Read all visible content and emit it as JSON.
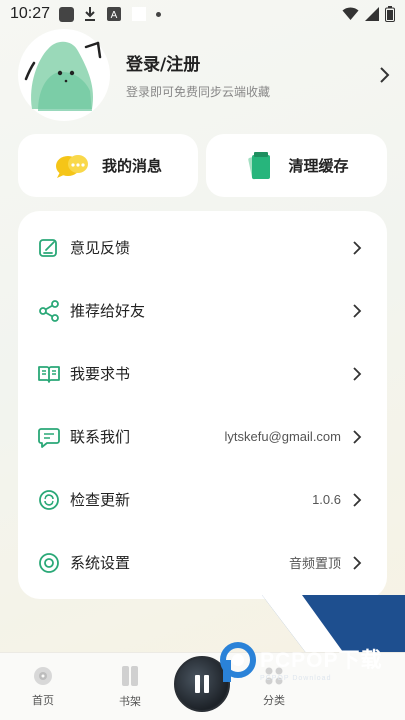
{
  "status_bar": {
    "time": "10:27"
  },
  "profile": {
    "title": "登录/注册",
    "subtitle": "登录即可免费同步云端收藏"
  },
  "quick_actions": [
    {
      "label": "我的消息",
      "icon": "chat-bubbles-icon"
    },
    {
      "label": "清理缓存",
      "icon": "broom-cards-icon"
    }
  ],
  "menu": [
    {
      "label": "意见反馈",
      "value": "",
      "icon": "feedback-edit-icon"
    },
    {
      "label": "推荐给好友",
      "value": "",
      "icon": "share-icon"
    },
    {
      "label": "我要求书",
      "value": "",
      "icon": "book-icon"
    },
    {
      "label": "联系我们",
      "value": "lytskefu@gmail.com",
      "icon": "message-icon"
    },
    {
      "label": "检查更新",
      "value": "1.0.6",
      "icon": "update-icon"
    },
    {
      "label": "系统设置",
      "value": "音频置顶",
      "icon": "settings-icon"
    }
  ],
  "tabs": [
    {
      "label": "首页",
      "icon": "disc-icon"
    },
    {
      "label": "书架",
      "icon": "bookshelf-icon"
    },
    {
      "label": "分类",
      "icon": "grid-icon"
    }
  ],
  "watermark": {
    "main": "PCPOP下载",
    "sub": "PCPOP Download"
  },
  "colors": {
    "accent": "#22b07a",
    "menu_icon": "#2aa877",
    "yellow": "#f5c518"
  }
}
